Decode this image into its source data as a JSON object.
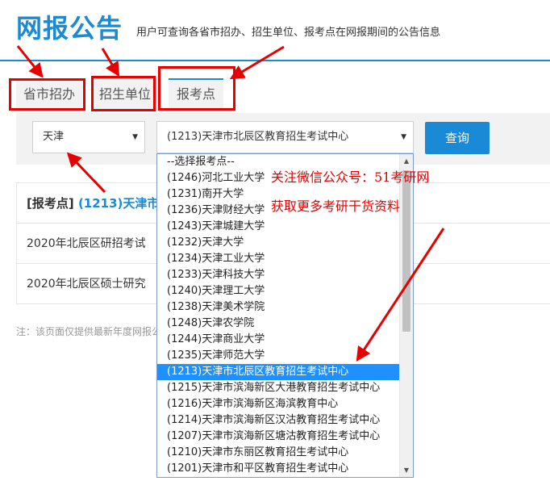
{
  "header": {
    "title": "网报公告",
    "subtitle": "用户可查询各省市招办、招生单位、报考点在网报期间的公告信息"
  },
  "tabs": [
    {
      "label": "省市招办"
    },
    {
      "label": "招生单位"
    },
    {
      "label": "报考点"
    }
  ],
  "search": {
    "province_value": "天津",
    "site_value": "(1213)天津市北辰区教育招生考试中心",
    "query_label": "查询"
  },
  "results": {
    "header_prefix": "[报考点]",
    "header_site": "(1213)天津市北辰区教育招生考试中心",
    "rows": [
      "2020年北辰区研招考试",
      "2020年北辰区硕士研究"
    ]
  },
  "footnote": "注：该页面仅提供最新年度网报公告信息",
  "dropdown": {
    "options": [
      "--选择报考点--",
      "(1246)河北工业大学",
      "(1231)南开大学",
      "(1236)天津财经大学",
      "(1243)天津城建大学",
      "(1232)天津大学",
      "(1234)天津工业大学",
      "(1233)天津科技大学",
      "(1240)天津理工大学",
      "(1238)天津美术学院",
      "(1248)天津农学院",
      "(1244)天津商业大学",
      "(1235)天津师范大学",
      "(1213)天津市北辰区教育招生考试中心",
      "(1215)天津市滨海新区大港教育招生考试中心",
      "(1216)天津市滨海新区海滨教育中心",
      "(1214)天津市滨海新区汉沽教育招生考试中心",
      "(1207)天津市滨海新区塘沽教育招生考试中心",
      "(1210)天津市东丽区教育招生考试中心",
      "(1201)天津市和平区教育招生考试中心"
    ],
    "selected_index": 13
  },
  "watermark": {
    "line1": "关注微信公众号：51考研网",
    "line2": "获取更多考研干货资料"
  },
  "colors": {
    "accent": "#1a8ad6",
    "annotation": "#e60000",
    "selected_option": "#1e90ff"
  }
}
